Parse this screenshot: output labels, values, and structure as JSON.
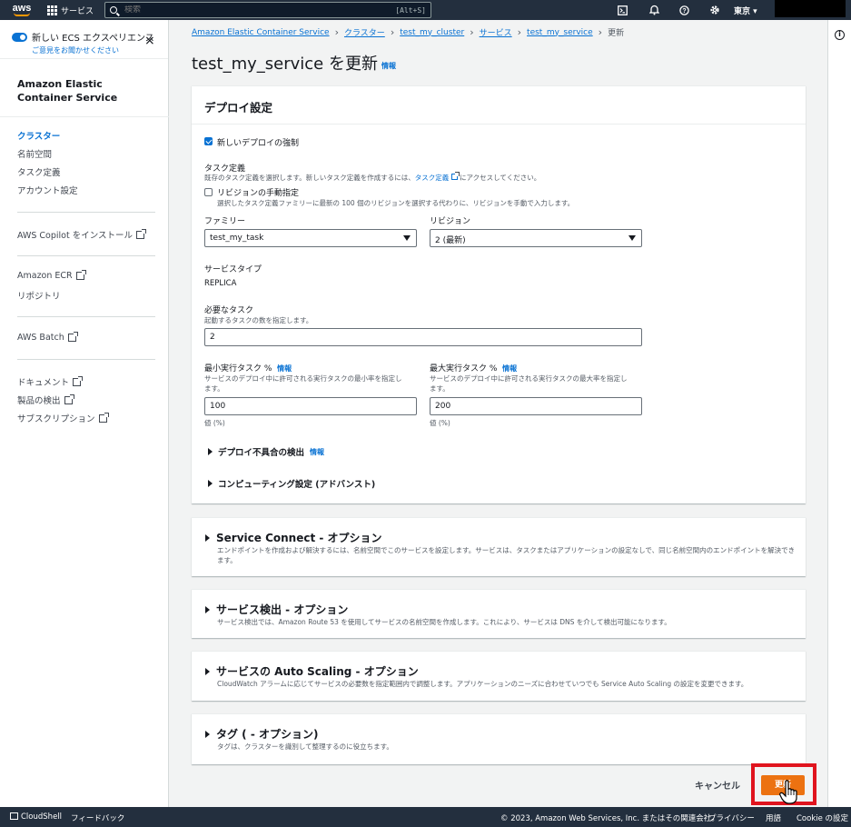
{
  "topnav": {
    "logo_text": "aws",
    "services_label": "サービス",
    "search_placeholder": "検索",
    "search_shortcut": "[Alt+S]",
    "region": "東京 ▾"
  },
  "sidebar": {
    "new_experience_label": "新しい ECS エクスペリエンス",
    "feedback_link": "ご意見をお聞かせください",
    "service_title_line1": "Amazon Elastic",
    "service_title_line2": "Container Service",
    "items": [
      {
        "label": "クラスター"
      },
      {
        "label": "名前空間"
      },
      {
        "label": "タスク定義"
      },
      {
        "label": "アカウント設定"
      }
    ],
    "copilot": "AWS Copilot をインストール",
    "ecr": "Amazon ECR",
    "repo": "リポジトリ",
    "batch": "AWS Batch",
    "docs": "ドキュメント",
    "discover": "製品の検出",
    "subs": "サブスクリプション"
  },
  "breadcrumb": {
    "items": [
      "Amazon Elastic Container Service",
      "クラスター",
      "test_my_cluster",
      "サービス",
      "test_my_service"
    ],
    "current": "更新"
  },
  "page": {
    "title": "test_my_service を更新",
    "info": "情報"
  },
  "deploy": {
    "heading": "デプロイ設定",
    "force_new": "新しいデプロイの強制",
    "taskdef_label": "タスク定義",
    "taskdef_desc_pre": "既存のタスク定義を選択します。新しいタスク定義を作成するには、",
    "taskdef_desc_link": "タスク定義",
    "taskdef_desc_post": "にアクセスしてください。",
    "manual_rev_label": "リビジョンの手動指定",
    "manual_rev_desc": "選択したタスク定義ファミリーに最新の 100 個のリビジョンを選択する代わりに、リビジョンを手動で入力します。",
    "family_label": "ファミリー",
    "family_value": "test_my_task",
    "revision_label": "リビジョン",
    "revision_value": "2 (最新)",
    "service_type_label": "サービスタイプ",
    "service_type_value": "REPLICA",
    "desired_label": "必要なタスク",
    "desired_desc": "起動するタスクの数を指定します。",
    "desired_value": "2",
    "min_label": "最小実行タスク %",
    "min_desc_1": "サービスのデプロイ中に許可される実行タスクの最小率を指定し",
    "min_desc_2": "ます。",
    "min_value": "100",
    "min_unit": "値 (%)",
    "max_label": "最大実行タスク %",
    "max_desc_1": "サービスのデプロイ中に許可される実行タスクの最大率を指定し",
    "max_desc_2": "ます。",
    "max_value": "200",
    "max_unit": "値 (%)",
    "failure_detect": "デプロイ不具合の検出",
    "compute_settings": "コンピューティング設定 (アドバンスト)"
  },
  "sections": {
    "service_connect_title": "Service Connect - オプション",
    "service_connect_desc": "エンドポイントを作成および解決するには、名前空間でこのサービスを設定します。サービスは、タスクまたはアプリケーションの設定なしで、同じ名前空間内のエンドポイントを解決できます。",
    "discovery_title": "サービス検出 - オプション",
    "discovery_desc": "サービス検出では、Amazon Route 53 を使用してサービスの名前空間を作成します。これにより、サービスは DNS を介して検出可能になります。",
    "autoscaling_title": "サービスの Auto Scaling - オプション",
    "autoscaling_desc": "CloudWatch アラームに応じてサービスの必要数を指定範囲内で調整します。アプリケーションのニーズに合わせていつでも Service Auto Scaling の設定を変更できます。",
    "tags_title": "タグ ( - オプション)",
    "tags_desc": "タグは、クラスターを識別して整理するのに役立ちます。"
  },
  "actions": {
    "cancel": "キャンセル",
    "update": "更新"
  },
  "footer": {
    "cloudshell": "CloudShell",
    "feedback": "フィードバック",
    "copyright": "© 2023, Amazon Web Services, Inc. またはその関連会社。",
    "privacy": "プライバシー",
    "terms": "用語",
    "cookie": "Cookie の設定"
  },
  "colors": {
    "nav_bg": "#232f3e",
    "link": "#0972d3",
    "primary_button": "#ec7211",
    "highlight": "#e0141e"
  }
}
